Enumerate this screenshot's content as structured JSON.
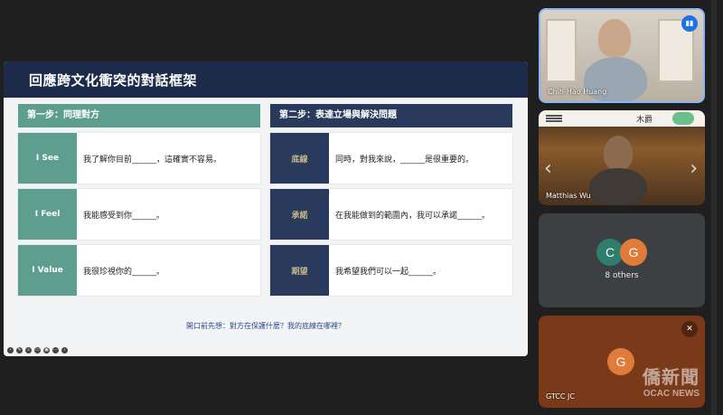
{
  "slide": {
    "title": "回應跨文化衝突的對話框架",
    "left_header": "第一步：同理對方",
    "right_header": "第二步：表達立場與解決問題",
    "left_cards": [
      {
        "label": "I See",
        "text": "我了解你目前______，這確實不容易。"
      },
      {
        "label": "I Feel",
        "text": "我能感受到你______。"
      },
      {
        "label": "I Value",
        "text": "我很珍視你的______。"
      }
    ],
    "right_cards": [
      {
        "label": "底線",
        "text": "同時，對我來說，______是很重要的。"
      },
      {
        "label": "承諾",
        "text": "在我能做到的範圍內，我可以承諾______。"
      },
      {
        "label": "期望",
        "text": "我希望我們可以一起______。"
      }
    ],
    "footer_question": "開口前先想：對方在保護什麼？我的底線在哪裡？"
  },
  "participants": {
    "tile1_name": "Chih-Hao Huang",
    "tile2_name": "Matthias Wu",
    "tile2_banner": "木爵",
    "tile3_avatar1": "C",
    "tile3_avatar2": "G",
    "tile3_others": "8 others",
    "tile4_avatar": "G",
    "tile4_name": "GTCC JC"
  },
  "watermark": {
    "line1": "僑新聞",
    "line2": "OCAC NEWS"
  },
  "colors": {
    "teal": "#5e9e8e",
    "navy": "#2a3a5c",
    "header": "#1d2b4a",
    "avatar_c": "#2f7d6d",
    "avatar_g": "#e07b39"
  }
}
